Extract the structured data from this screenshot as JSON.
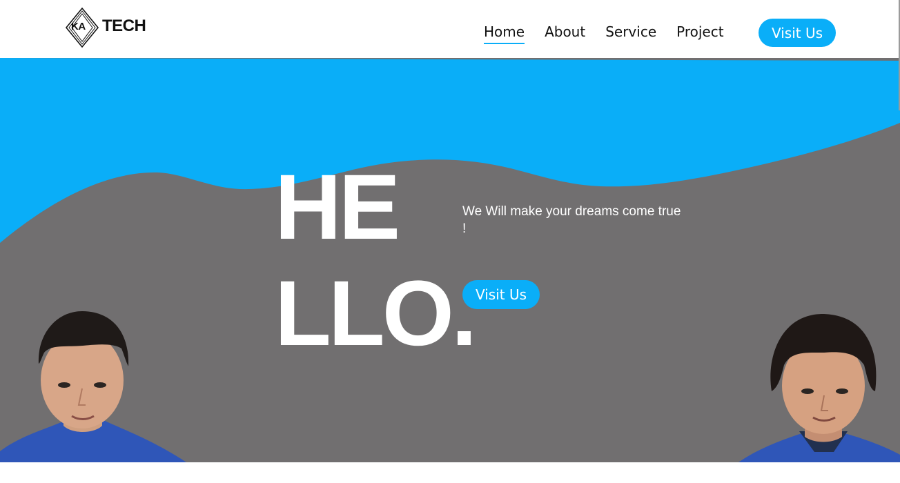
{
  "brand": {
    "mark_text": "KA",
    "name": "TECH"
  },
  "nav": {
    "items": [
      {
        "label": "Home",
        "active": true
      },
      {
        "label": "About",
        "active": false
      },
      {
        "label": "Service",
        "active": false
      },
      {
        "label": "Project",
        "active": false
      }
    ],
    "cta_label": "Visit Us"
  },
  "hero": {
    "headline_line1": "HE",
    "headline_line2": "LLO.",
    "tagline": "We Will make your dreams come true !",
    "cta_label": "Visit Us"
  },
  "colors": {
    "accent": "#0aaef8",
    "hero_background": "#716f70",
    "text_dark": "#111111",
    "white": "#ffffff"
  },
  "icons": {
    "logo": "diamond-logo-icon"
  }
}
